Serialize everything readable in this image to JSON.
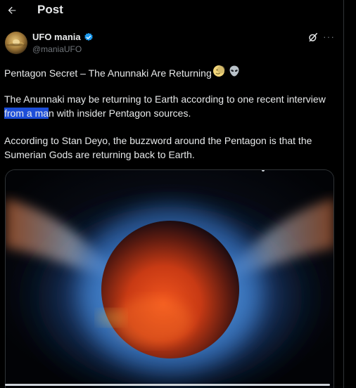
{
  "header": {
    "title": "Post",
    "back_icon": "arrow-left-icon"
  },
  "author": {
    "display_name": "UFO mania",
    "handle": "@maniaUFO",
    "verified_color": "#1d9bf0"
  },
  "post": {
    "title_line": "Pentagon Secret – The Anunnaki Are Returning",
    "title_emojis": [
      "moon-face-emoji",
      "alien-emoji"
    ],
    "para2_before": "The Anunnaki may be returning to Earth according to one recent interview ",
    "para2_highlight": "from a ma",
    "para2_after": "n with insider Pentagon sources.",
    "para3": "According to Stan Deyo, the buzzword around the Pentagon is that the Sumerian Gods are returning back to Earth."
  },
  "media": {
    "description_icon": "glowing-planet-image",
    "progress": 0
  },
  "colors": {
    "background": "#000000",
    "text": "#e7e9ea",
    "muted": "#71767b",
    "accent": "#1d9bf0",
    "selection": "#1d4ed8"
  }
}
